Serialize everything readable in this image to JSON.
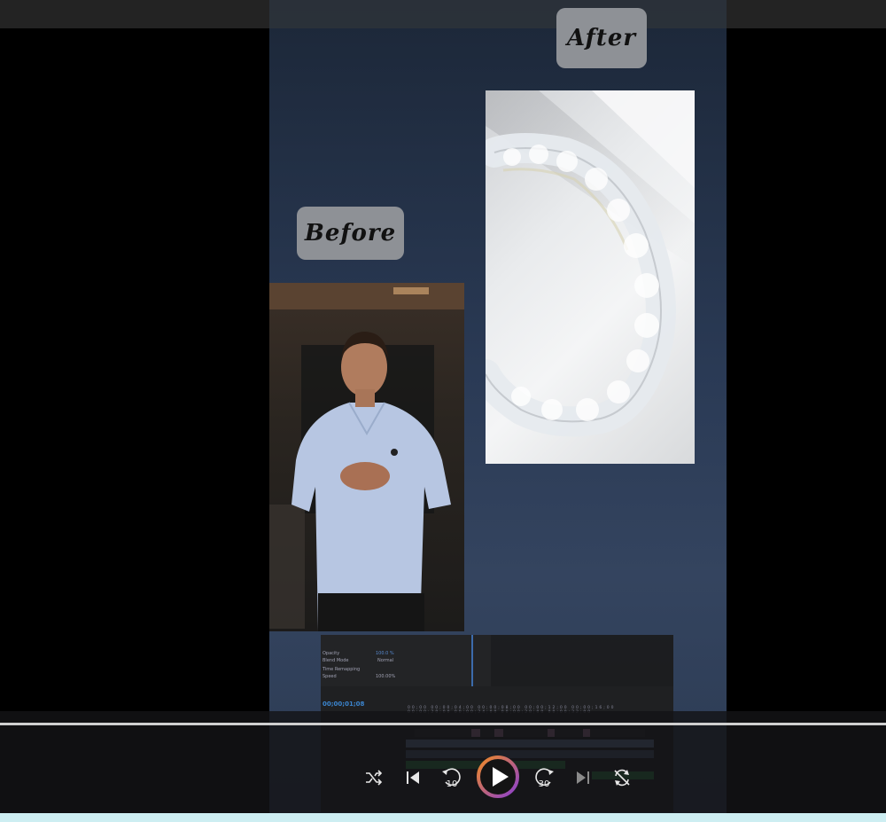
{
  "labels": {
    "before": "Before",
    "after": "After"
  },
  "editor": {
    "timecode": "00;00;01;08",
    "effect_rows": [
      {
        "name": "Opacity",
        "value": "100.0 %"
      },
      {
        "name": "Blend Mode",
        "value": "Normal"
      },
      {
        "name": "Time Remapping",
        "value": ""
      },
      {
        "name": "Speed",
        "value": "100.00%"
      }
    ],
    "ruler_ticks": [
      "00;00",
      "00;00;04;00",
      "00;00;08;00",
      "00;00;12;00",
      "00;00;16;00",
      "00;00;20;00",
      "00;00;24;00",
      "00;00;28;00",
      "00;00;32;00"
    ]
  },
  "player": {
    "progress": 0.0,
    "skip_back_seconds": "10",
    "skip_forward_seconds": "30"
  },
  "icons": {
    "shuffle": "shuffle-icon",
    "previous": "skip-previous-icon",
    "rewind": "rewind-10-icon",
    "play": "play-icon",
    "forward": "forward-30-icon",
    "next": "skip-next-icon",
    "repeat": "repeat-icon"
  },
  "colors": {
    "play_ring_start": "#f08a24",
    "play_ring_end": "#8a3fd1",
    "track_green": "#2f8a4a",
    "timecode_blue": "#3d8bd8"
  }
}
